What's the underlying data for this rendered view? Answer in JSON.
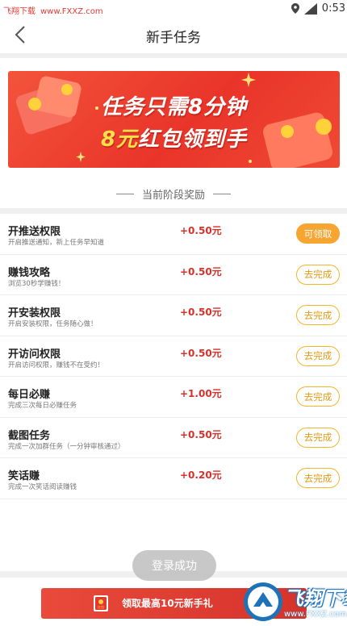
{
  "status_bar": {
    "watermark_cn": "飞翔下载",
    "watermark_site": "www.FXXZ.com",
    "time": "0:53"
  },
  "nav": {
    "title": "新手任务"
  },
  "banner": {
    "line1": "任务只需8分钟",
    "line2_amount": "8元",
    "line2_rest": "红包领到手"
  },
  "section": {
    "title": "当前阶段奖励"
  },
  "tasks": [
    {
      "title": "开推送权限",
      "desc": "开启推送通知，新上任务早知道",
      "reward": "+0.50元",
      "button": "可领取"
    },
    {
      "title": "赚钱攻略",
      "desc": "浏览30秒学赚钱！",
      "reward": "+0.50元",
      "button": "去完成"
    },
    {
      "title": "开安装权限",
      "desc": "开启安装权限，任务随心做！",
      "reward": "+0.50元",
      "button": "去完成"
    },
    {
      "title": "开访问权限",
      "desc": "开启访问权限，赚钱不在受约！",
      "reward": "+0.50元",
      "button": "去完成"
    },
    {
      "title": "每日必赚",
      "desc": "完成三次每日必赚任务",
      "reward": "+1.00元",
      "button": "去完成"
    },
    {
      "title": "截图任务",
      "desc": "完成一次加群任务（一分钟审核通过）",
      "reward": "+0.50元",
      "button": "去完成"
    },
    {
      "title": "笑话赚",
      "desc": "完成一次笑话阅读赚钱",
      "reward": "+0.20元",
      "button": "去完成"
    }
  ],
  "toast": {
    "text": "登录成功"
  },
  "bottom": {
    "envelope_label": "红包",
    "cta": "领取最高10元新手礼"
  },
  "watermark_logo": {
    "cn": "飞翔下载",
    "url": "www.FXXZ.com"
  },
  "colors": {
    "reward_red": "#d8302a",
    "button_orange": "#f6a531",
    "banner_red": "#e9342a"
  }
}
